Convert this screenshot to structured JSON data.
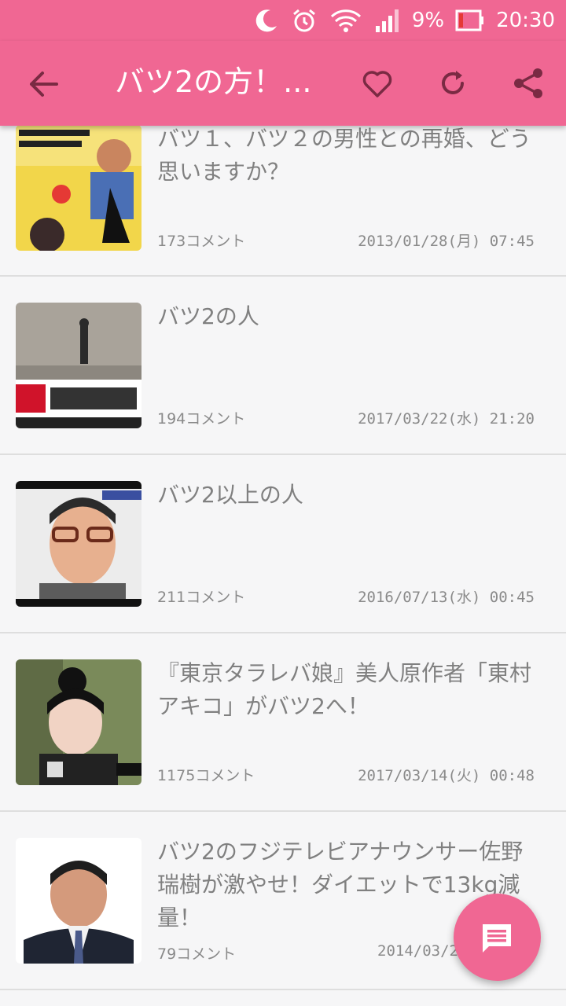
{
  "status_bar": {
    "battery_percent": "9%",
    "time": "20:30",
    "icons": [
      "moon-icon",
      "alarm-icon",
      "wifi-icon",
      "signal-icon",
      "battery-icon"
    ]
  },
  "app_bar": {
    "title": "バツ2の方！...",
    "icons": [
      "back-arrow-icon",
      "heart-icon",
      "refresh-icon",
      "share-icon"
    ],
    "color": "#f06793"
  },
  "list": [
    {
      "title": "バツ１、バツ２の男性との再婚、どう思いますか？",
      "comments": "173コメント",
      "date": "2013/01/28(月) 07:45"
    },
    {
      "title": "バツ2の人",
      "comments": "194コメント",
      "date": "2017/03/22(水) 21:20"
    },
    {
      "title": "バツ2以上の人",
      "comments": "211コメント",
      "date": "2016/07/13(水) 00:45"
    },
    {
      "title": "『東京タラレバ娘』美人原作者「東村アキコ」がバツ2へ！",
      "comments": "1175コメント",
      "date": "2017/03/14(火) 00:48"
    },
    {
      "title": "バツ2のフジテレビアナウンサー佐野瑞樹が激やせ！ダイエットで13kg減量！",
      "comments": "79コメント",
      "date": "2014/03/27"
    }
  ],
  "fab": {
    "icon": "comment-icon"
  }
}
